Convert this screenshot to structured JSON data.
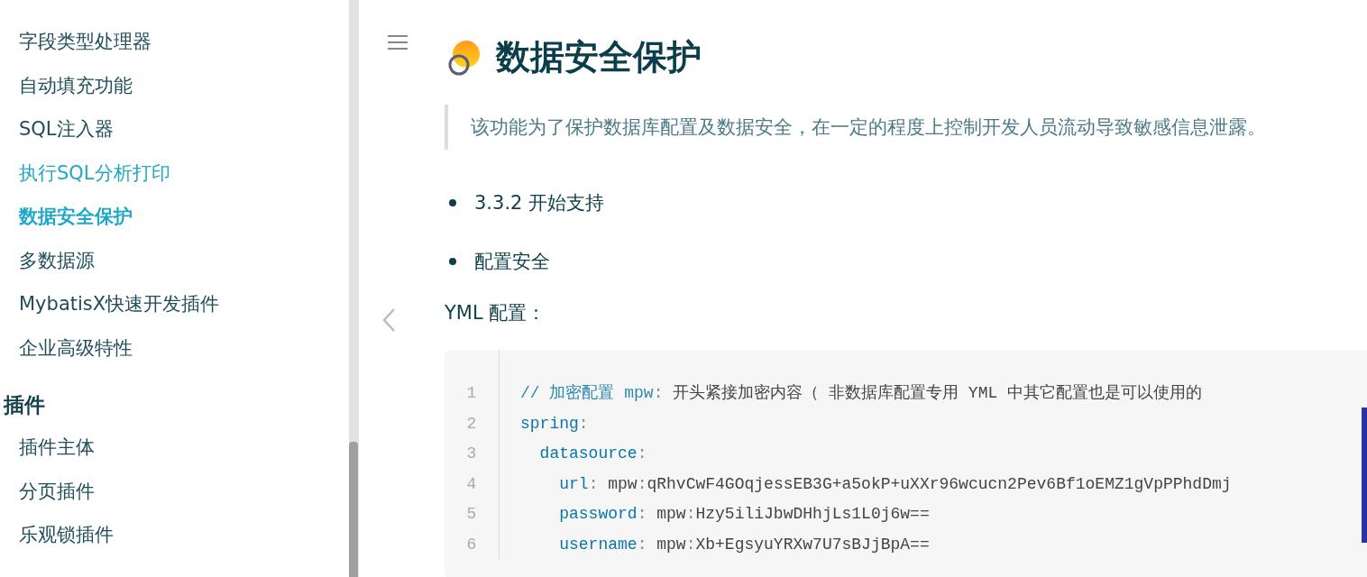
{
  "sidebar": {
    "groups": [
      {
        "items": [
          {
            "label": "字段类型处理器",
            "selected": false,
            "hovered": false
          },
          {
            "label": "自动填充功能",
            "selected": false,
            "hovered": false
          },
          {
            "label": "SQL注入器",
            "selected": false,
            "hovered": false
          },
          {
            "label": "执行SQL分析打印",
            "selected": false,
            "hovered": true
          },
          {
            "label": "数据安全保护",
            "selected": true,
            "hovered": false
          },
          {
            "label": "多数据源",
            "selected": false,
            "hovered": false
          },
          {
            "label": "MybatisX快速开发插件",
            "selected": false,
            "hovered": false
          },
          {
            "label": "企业高级特性",
            "selected": false,
            "hovered": false
          }
        ]
      },
      {
        "heading": "插件",
        "items": [
          {
            "label": "插件主体",
            "selected": false,
            "hovered": false
          },
          {
            "label": "分页插件",
            "selected": false,
            "hovered": false
          },
          {
            "label": "乐观锁插件",
            "selected": false,
            "hovered": false
          }
        ]
      }
    ]
  },
  "article": {
    "title": "数据安全保护",
    "quote": "该功能为了保护数据库配置及数据安全，在一定的程度上控制开发人员流动导致敏感信息泄露。",
    "bullets": [
      "3.3.2 开始支持",
      "配置安全"
    ],
    "paragraph": "YML 配置：",
    "code": [
      {
        "number": "1",
        "tokens": [
          {
            "kind": "comment",
            "text": "// 加密配置 mpw"
          },
          {
            "kind": "punct",
            "text": ": "
          },
          {
            "kind": "plain",
            "text": "开头紧接加密内容（ 非数据库配置专用 YML 中其它配置也是可以使用的"
          }
        ]
      },
      {
        "number": "2",
        "tokens": [
          {
            "kind": "key",
            "text": "spring"
          },
          {
            "kind": "punct",
            "text": ":"
          }
        ]
      },
      {
        "number": "3",
        "tokens": [
          {
            "kind": "key",
            "text": "  datasource"
          },
          {
            "kind": "punct",
            "text": ":"
          }
        ]
      },
      {
        "number": "4",
        "tokens": [
          {
            "kind": "key",
            "text": "    url"
          },
          {
            "kind": "punct",
            "text": ": "
          },
          {
            "kind": "plain",
            "text": "mpw"
          },
          {
            "kind": "punct",
            "text": ":"
          },
          {
            "kind": "plain",
            "text": "qRhvCwF4GOqjessEB3G+a5okP+uXXr96wcucn2Pev6Bf1oEMZ1gVpPPhdDmj"
          }
        ]
      },
      {
        "number": "5",
        "tokens": [
          {
            "kind": "key",
            "text": "    password"
          },
          {
            "kind": "punct",
            "text": ": "
          },
          {
            "kind": "plain",
            "text": "mpw"
          },
          {
            "kind": "punct",
            "text": ":"
          },
          {
            "kind": "plain",
            "text": "Hzy5iliJbwDHhjLs1L0j6w=="
          }
        ]
      },
      {
        "number": "6",
        "tokens": [
          {
            "kind": "key",
            "text": "    username"
          },
          {
            "kind": "punct",
            "text": ": "
          },
          {
            "kind": "plain",
            "text": "mpw"
          },
          {
            "kind": "punct",
            "text": ":"
          },
          {
            "kind": "plain",
            "text": "Xb+EgsyuYRXw7U7sBJjBpA=="
          }
        ]
      }
    ]
  }
}
